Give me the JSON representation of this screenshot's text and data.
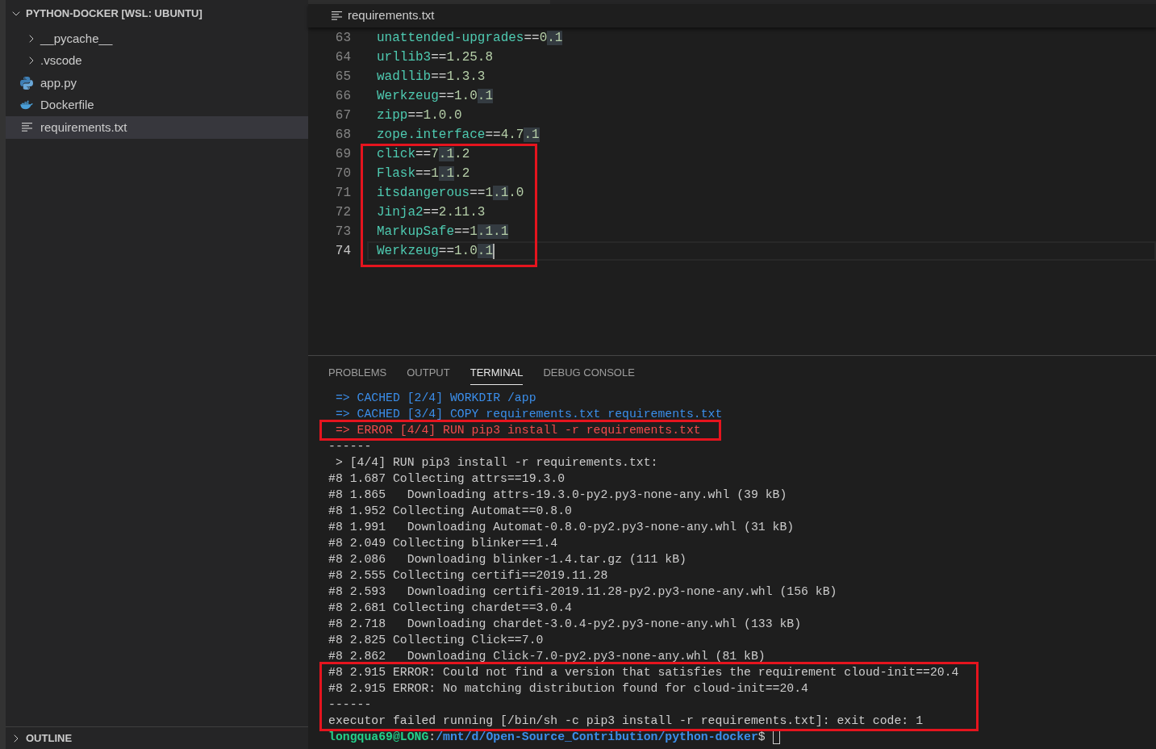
{
  "explorer": {
    "root": {
      "label": "PYTHON-DOCKER [WSL: UBUNTU]",
      "expanded": true,
      "children": [
        {
          "kind": "folder",
          "label": "__pycache__",
          "expanded": false,
          "selected": false
        },
        {
          "kind": "folder",
          "label": ".vscode",
          "expanded": false,
          "selected": false
        },
        {
          "kind": "python",
          "label": "app.py",
          "selected": false
        },
        {
          "kind": "docker",
          "label": "Dockerfile",
          "selected": false
        },
        {
          "kind": "text",
          "label": "requirements.txt",
          "selected": true
        }
      ]
    },
    "outline": {
      "label": "OUTLINE",
      "expanded": false
    }
  },
  "editor": {
    "file_tab": {
      "label": "requirements.txt"
    },
    "blocks": [
      {
        "boxed": false,
        "lines": [
          {
            "number": "63",
            "current": false,
            "tokens": [
              {
                "kind": "name",
                "text": "unattended-upgrades",
                "highlighted": false
              },
              {
                "kind": "operator",
                "text": "==",
                "highlighted": false
              },
              {
                "kind": "version",
                "text": "0",
                "highlighted": false
              },
              {
                "kind": "version",
                "text": ".1",
                "highlighted": true
              }
            ]
          },
          {
            "number": "64",
            "current": false,
            "tokens": [
              {
                "kind": "name",
                "text": "urllib3",
                "highlighted": false
              },
              {
                "kind": "operator",
                "text": "==",
                "highlighted": false
              },
              {
                "kind": "version",
                "text": "1.25.8",
                "highlighted": false
              }
            ]
          },
          {
            "number": "65",
            "current": false,
            "tokens": [
              {
                "kind": "name",
                "text": "wadllib",
                "highlighted": false
              },
              {
                "kind": "operator",
                "text": "==",
                "highlighted": false
              },
              {
                "kind": "version",
                "text": "1.3.3",
                "highlighted": false
              }
            ]
          },
          {
            "number": "66",
            "current": false,
            "tokens": [
              {
                "kind": "name",
                "text": "Werkzeug",
                "highlighted": false
              },
              {
                "kind": "operator",
                "text": "==",
                "highlighted": false
              },
              {
                "kind": "version",
                "text": "1.0",
                "highlighted": false
              },
              {
                "kind": "version",
                "text": ".1",
                "highlighted": true
              }
            ]
          },
          {
            "number": "67",
            "current": false,
            "tokens": [
              {
                "kind": "name",
                "text": "zipp",
                "highlighted": false
              },
              {
                "kind": "operator",
                "text": "==",
                "highlighted": false
              },
              {
                "kind": "version",
                "text": "1.0.0",
                "highlighted": false
              }
            ]
          },
          {
            "number": "68",
            "current": false,
            "tokens": [
              {
                "kind": "name",
                "text": "zope.interface",
                "highlighted": false
              },
              {
                "kind": "operator",
                "text": "==",
                "highlighted": false
              },
              {
                "kind": "version",
                "text": "4.7",
                "highlighted": false
              },
              {
                "kind": "version",
                "text": ".1",
                "highlighted": true
              }
            ]
          }
        ]
      },
      {
        "boxed": true,
        "lines": [
          {
            "number": "69",
            "current": false,
            "tokens": [
              {
                "kind": "name",
                "text": "click",
                "highlighted": false
              },
              {
                "kind": "operator",
                "text": "==",
                "highlighted": false
              },
              {
                "kind": "version",
                "text": "7",
                "highlighted": false
              },
              {
                "kind": "version",
                "text": ".1",
                "highlighted": true
              },
              {
                "kind": "version",
                "text": ".2",
                "highlighted": false
              }
            ]
          },
          {
            "number": "70",
            "current": false,
            "tokens": [
              {
                "kind": "name",
                "text": "Flask",
                "highlighted": false
              },
              {
                "kind": "operator",
                "text": "==",
                "highlighted": false
              },
              {
                "kind": "version",
                "text": "1",
                "highlighted": false
              },
              {
                "kind": "version",
                "text": ".1",
                "highlighted": true
              },
              {
                "kind": "version",
                "text": ".2",
                "highlighted": false
              }
            ]
          },
          {
            "number": "71",
            "current": false,
            "tokens": [
              {
                "kind": "name",
                "text": "itsdangerous",
                "highlighted": false
              },
              {
                "kind": "operator",
                "text": "==",
                "highlighted": false
              },
              {
                "kind": "version",
                "text": "1",
                "highlighted": false
              },
              {
                "kind": "version",
                "text": ".1",
                "highlighted": true
              },
              {
                "kind": "version",
                "text": ".0",
                "highlighted": false
              }
            ]
          },
          {
            "number": "72",
            "current": false,
            "tokens": [
              {
                "kind": "name",
                "text": "Jinja2",
                "highlighted": false
              },
              {
                "kind": "operator",
                "text": "==",
                "highlighted": false
              },
              {
                "kind": "version",
                "text": "2.11.3",
                "highlighted": false
              }
            ]
          },
          {
            "number": "73",
            "current": false,
            "tokens": [
              {
                "kind": "name",
                "text": "MarkupSafe",
                "highlighted": false
              },
              {
                "kind": "operator",
                "text": "==",
                "highlighted": false
              },
              {
                "kind": "version",
                "text": "1",
                "highlighted": false
              },
              {
                "kind": "version",
                "text": ".1.1",
                "highlighted": true
              }
            ]
          },
          {
            "number": "74",
            "current": true,
            "tokens": [
              {
                "kind": "name",
                "text": "Werkzeug",
                "highlighted": false
              },
              {
                "kind": "operator",
                "text": "==",
                "highlighted": false
              },
              {
                "kind": "version",
                "text": "1.0",
                "highlighted": false
              },
              {
                "kind": "version",
                "text": ".1",
                "highlighted": true
              }
            ]
          }
        ]
      }
    ]
  },
  "panel": {
    "tabs": [
      {
        "label": "PROBLEMS",
        "selected": false
      },
      {
        "label": "OUTPUT",
        "selected": false
      },
      {
        "label": "TERMINAL",
        "selected": true
      },
      {
        "label": "DEBUG CONSOLE",
        "selected": false
      }
    ],
    "terminal": {
      "blocks": [
        {
          "boxed": false,
          "lines": [
            {
              "kind": "info",
              "text": " => CACHED [2/4] WORKDIR /app"
            },
            {
              "kind": "info",
              "text": " => CACHED [3/4] COPY requirements.txt requirements.txt"
            }
          ]
        },
        {
          "boxed": true,
          "lines": [
            {
              "kind": "error",
              "text": " => ERROR [4/4] RUN pip3 install -r requirements.txt"
            }
          ]
        },
        {
          "boxed": false,
          "lines": [
            {
              "kind": "plain",
              "text": "------"
            },
            {
              "kind": "plain",
              "text": " > [4/4] RUN pip3 install -r requirements.txt:"
            },
            {
              "kind": "plain",
              "text": "#8 1.687 Collecting attrs==19.3.0"
            },
            {
              "kind": "plain",
              "text": "#8 1.865   Downloading attrs-19.3.0-py2.py3-none-any.whl (39 kB)"
            },
            {
              "kind": "plain",
              "text": "#8 1.952 Collecting Automat==0.8.0"
            },
            {
              "kind": "plain",
              "text": "#8 1.991   Downloading Automat-0.8.0-py2.py3-none-any.whl (31 kB)"
            },
            {
              "kind": "plain",
              "text": "#8 2.049 Collecting blinker==1.4"
            },
            {
              "kind": "plain",
              "text": "#8 2.086   Downloading blinker-1.4.tar.gz (111 kB)"
            },
            {
              "kind": "plain",
              "text": "#8 2.555 Collecting certifi==2019.11.28"
            },
            {
              "kind": "plain",
              "text": "#8 2.593   Downloading certifi-2019.11.28-py2.py3-none-any.whl (156 kB)"
            },
            {
              "kind": "plain",
              "text": "#8 2.681 Collecting chardet==3.0.4"
            },
            {
              "kind": "plain",
              "text": "#8 2.718   Downloading chardet-3.0.4-py2.py3-none-any.whl (133 kB)"
            },
            {
              "kind": "plain",
              "text": "#8 2.825 Collecting Click==7.0"
            },
            {
              "kind": "plain",
              "text": "#8 2.862   Downloading Click-7.0-py2.py3-none-any.whl (81 kB)"
            }
          ]
        },
        {
          "boxed": true,
          "lines": [
            {
              "kind": "plain",
              "text": "#8 2.915 ERROR: Could not find a version that satisfies the requirement cloud-init==20.4"
            },
            {
              "kind": "plain",
              "text": "#8 2.915 ERROR: No matching distribution found for cloud-init==20.4"
            },
            {
              "kind": "plain",
              "text": "------"
            },
            {
              "kind": "plain",
              "text": "executor failed running [/bin/sh -c pip3 install -r requirements.txt]: exit code: 1"
            }
          ]
        }
      ],
      "prompt": {
        "user": "longqua69@LONG",
        "separator": ":",
        "path": "/mnt/d/Open-Source_Contribution/python-docker",
        "symbol": "$"
      }
    }
  }
}
